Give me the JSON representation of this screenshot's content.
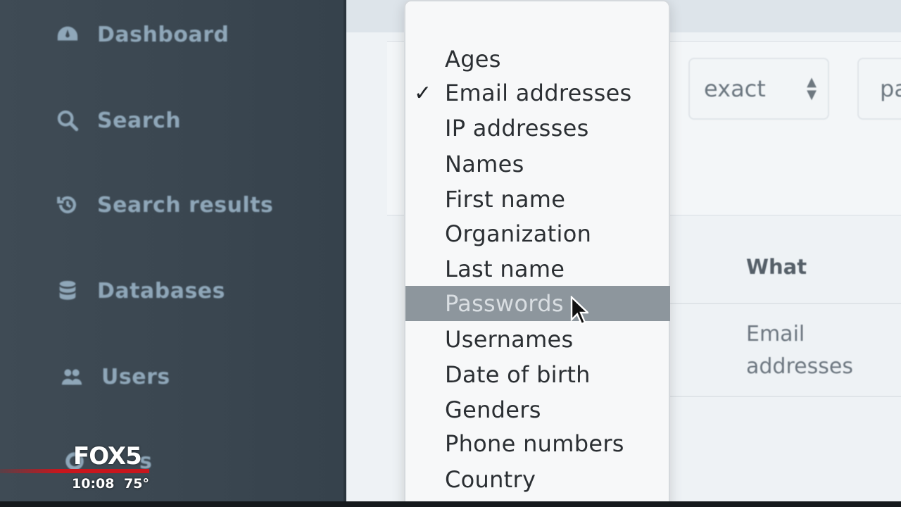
{
  "sidebar": {
    "items": [
      {
        "label": "Dashboard",
        "icon": "dashboard-icon"
      },
      {
        "label": "Search",
        "icon": "search-icon"
      },
      {
        "label": "Search results",
        "icon": "history-icon"
      },
      {
        "label": "Databases",
        "icon": "database-icon"
      },
      {
        "label": "Users",
        "icon": "users-icon"
      },
      {
        "label": "s",
        "icon": "settings-icon"
      }
    ]
  },
  "filters": {
    "match_mode": "exact",
    "second_select_partial": "pa"
  },
  "dropdown": {
    "selected": "Email addresses",
    "highlighted": "Passwords",
    "options": [
      "Ages",
      "Email addresses",
      "IP addresses",
      "Names",
      "First name",
      "Organization",
      "Last name",
      "Passwords",
      "Usernames",
      "Date of birth",
      "Genders",
      "Phone numbers",
      "Country"
    ]
  },
  "table": {
    "column_header": "What",
    "cell_value": "Email addresses"
  },
  "broadcast": {
    "logo": "FOX5",
    "time": "10:08",
    "temperature": "75°",
    "brand_color": "#c8161d"
  }
}
